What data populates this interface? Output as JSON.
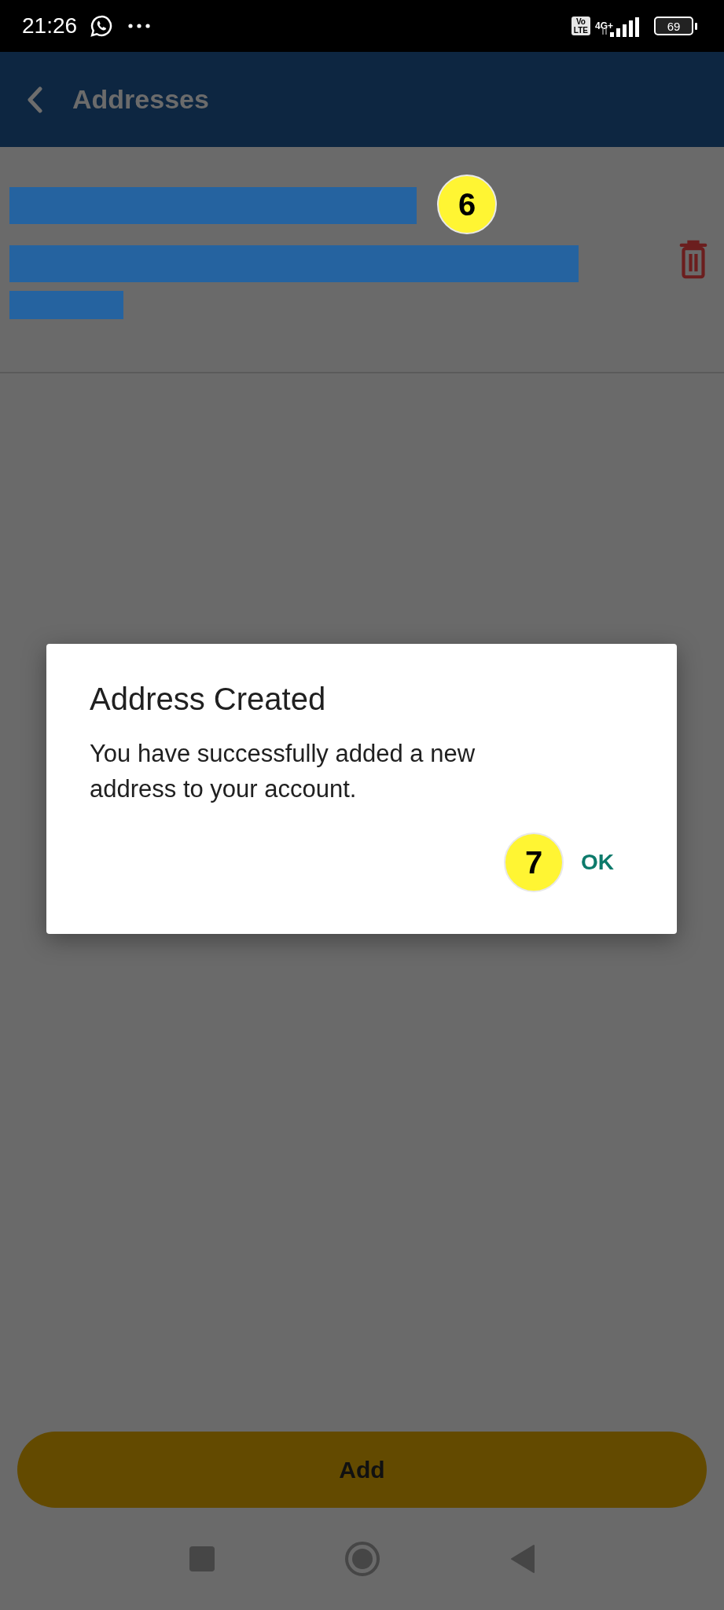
{
  "status_bar": {
    "time": "21:26",
    "volte": [
      "Vo",
      "LTE"
    ],
    "network": "4G+",
    "battery": "69"
  },
  "header": {
    "title": "Addresses"
  },
  "addresses": [
    {
      "badge": "6"
    }
  ],
  "dialog": {
    "title": "Address Created",
    "message": "You have successfully added a new address to your account.",
    "badge": "7",
    "button": "OK"
  },
  "add_button": {
    "label": "Add"
  }
}
